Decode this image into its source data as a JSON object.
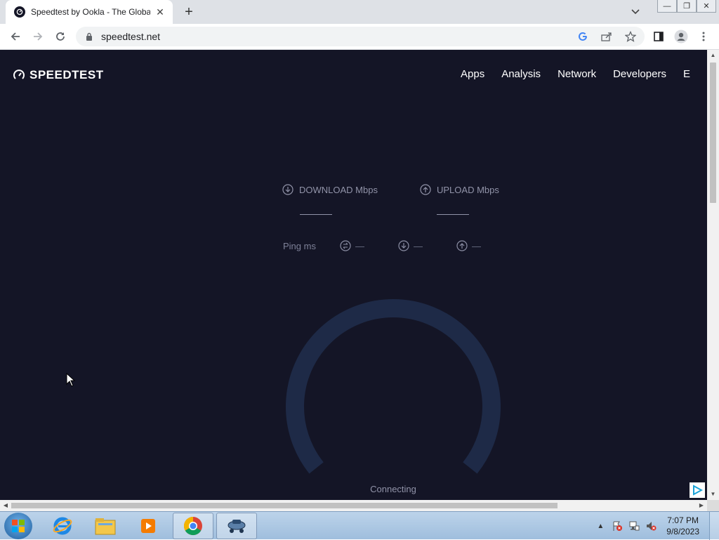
{
  "browser": {
    "tab": {
      "title": "Speedtest by Ookla - The Global",
      "close": "✕"
    },
    "new_tab": "+",
    "url": "speedtest.net",
    "window_controls": {
      "minimize": "—",
      "restore": "❐",
      "close": "✕"
    }
  },
  "page": {
    "logo_text": "SPEEDTEST",
    "nav": [
      "Apps",
      "Analysis",
      "Network",
      "Developers",
      "E"
    ],
    "download_label": "DOWNLOAD Mbps",
    "upload_label": "UPLOAD Mbps",
    "ping_label": "Ping ms",
    "ping_values": {
      "jitter": "—",
      "download": "—",
      "upload": "—"
    },
    "status": "Connecting"
  },
  "taskbar": {
    "apps": [
      "internet-explorer",
      "file-explorer",
      "media-player",
      "chrome",
      "network-app"
    ],
    "clock_time": "7:07 PM",
    "clock_date": "9/8/2023"
  },
  "colors": {
    "page_bg": "#141526",
    "gauge_track": "#1e2a47",
    "muted_text": "#9193a8"
  }
}
